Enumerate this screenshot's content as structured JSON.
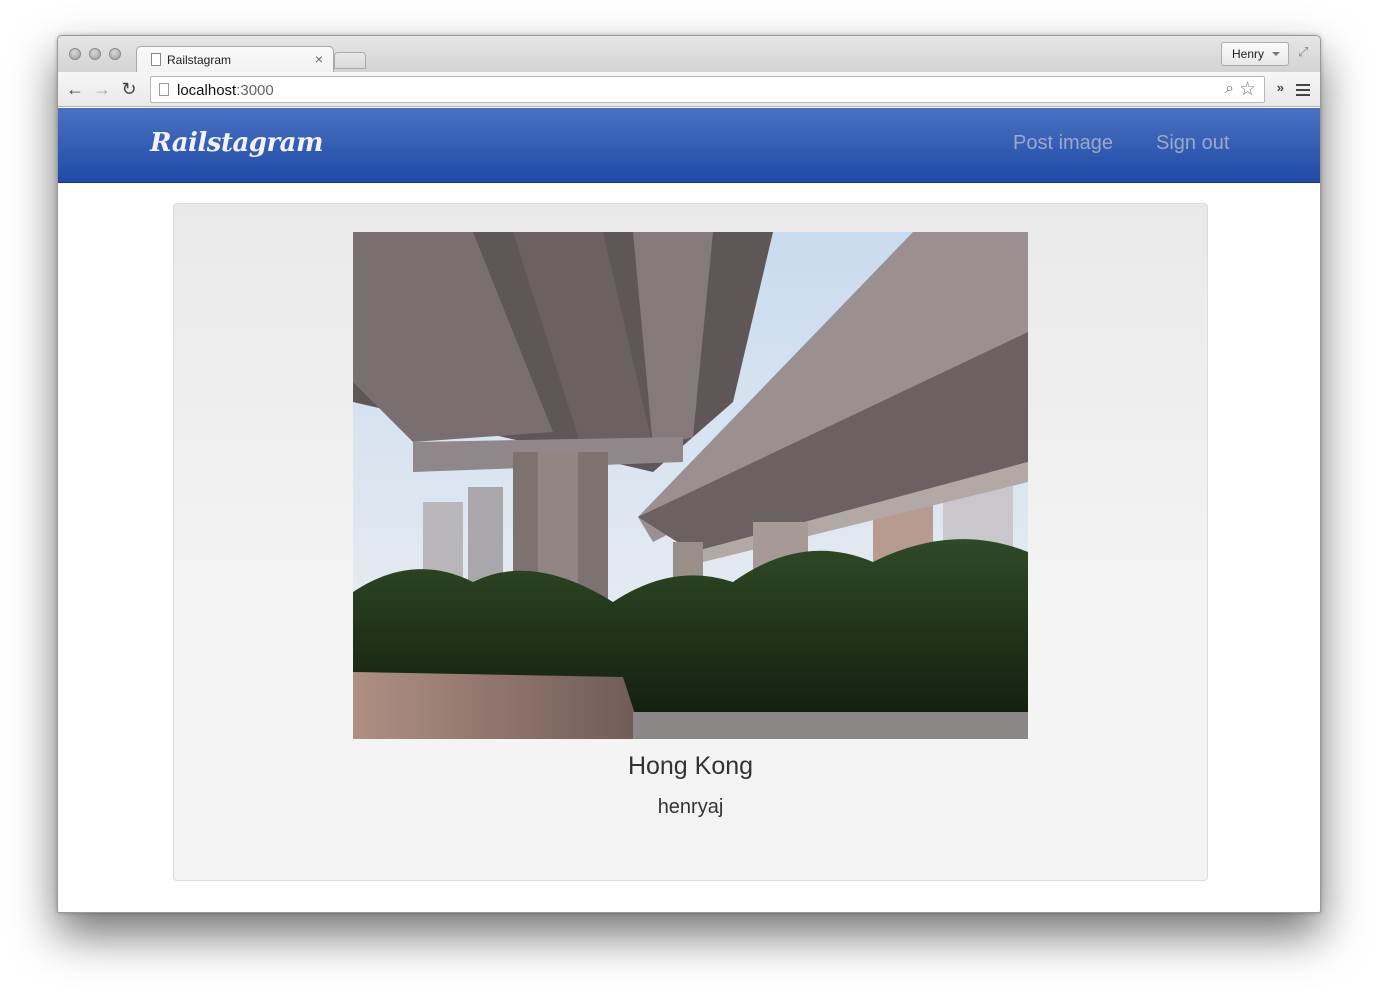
{
  "browser": {
    "tab_title": "Railstagram",
    "tab_close": "×",
    "profile_name": "Henry",
    "url_host": "localhost",
    "url_port": ":3000",
    "extensions_label": "»"
  },
  "navbar": {
    "brand": "Railstagram",
    "post_image": "Post image",
    "sign_out": "Sign out",
    "colors": {
      "top": "#4a72c2",
      "bottom": "#1f4aa6",
      "link": "#9aa9c8"
    }
  },
  "post": {
    "image_icon": "overpass-photo",
    "title": "Hong Kong",
    "username": "henryaj"
  }
}
